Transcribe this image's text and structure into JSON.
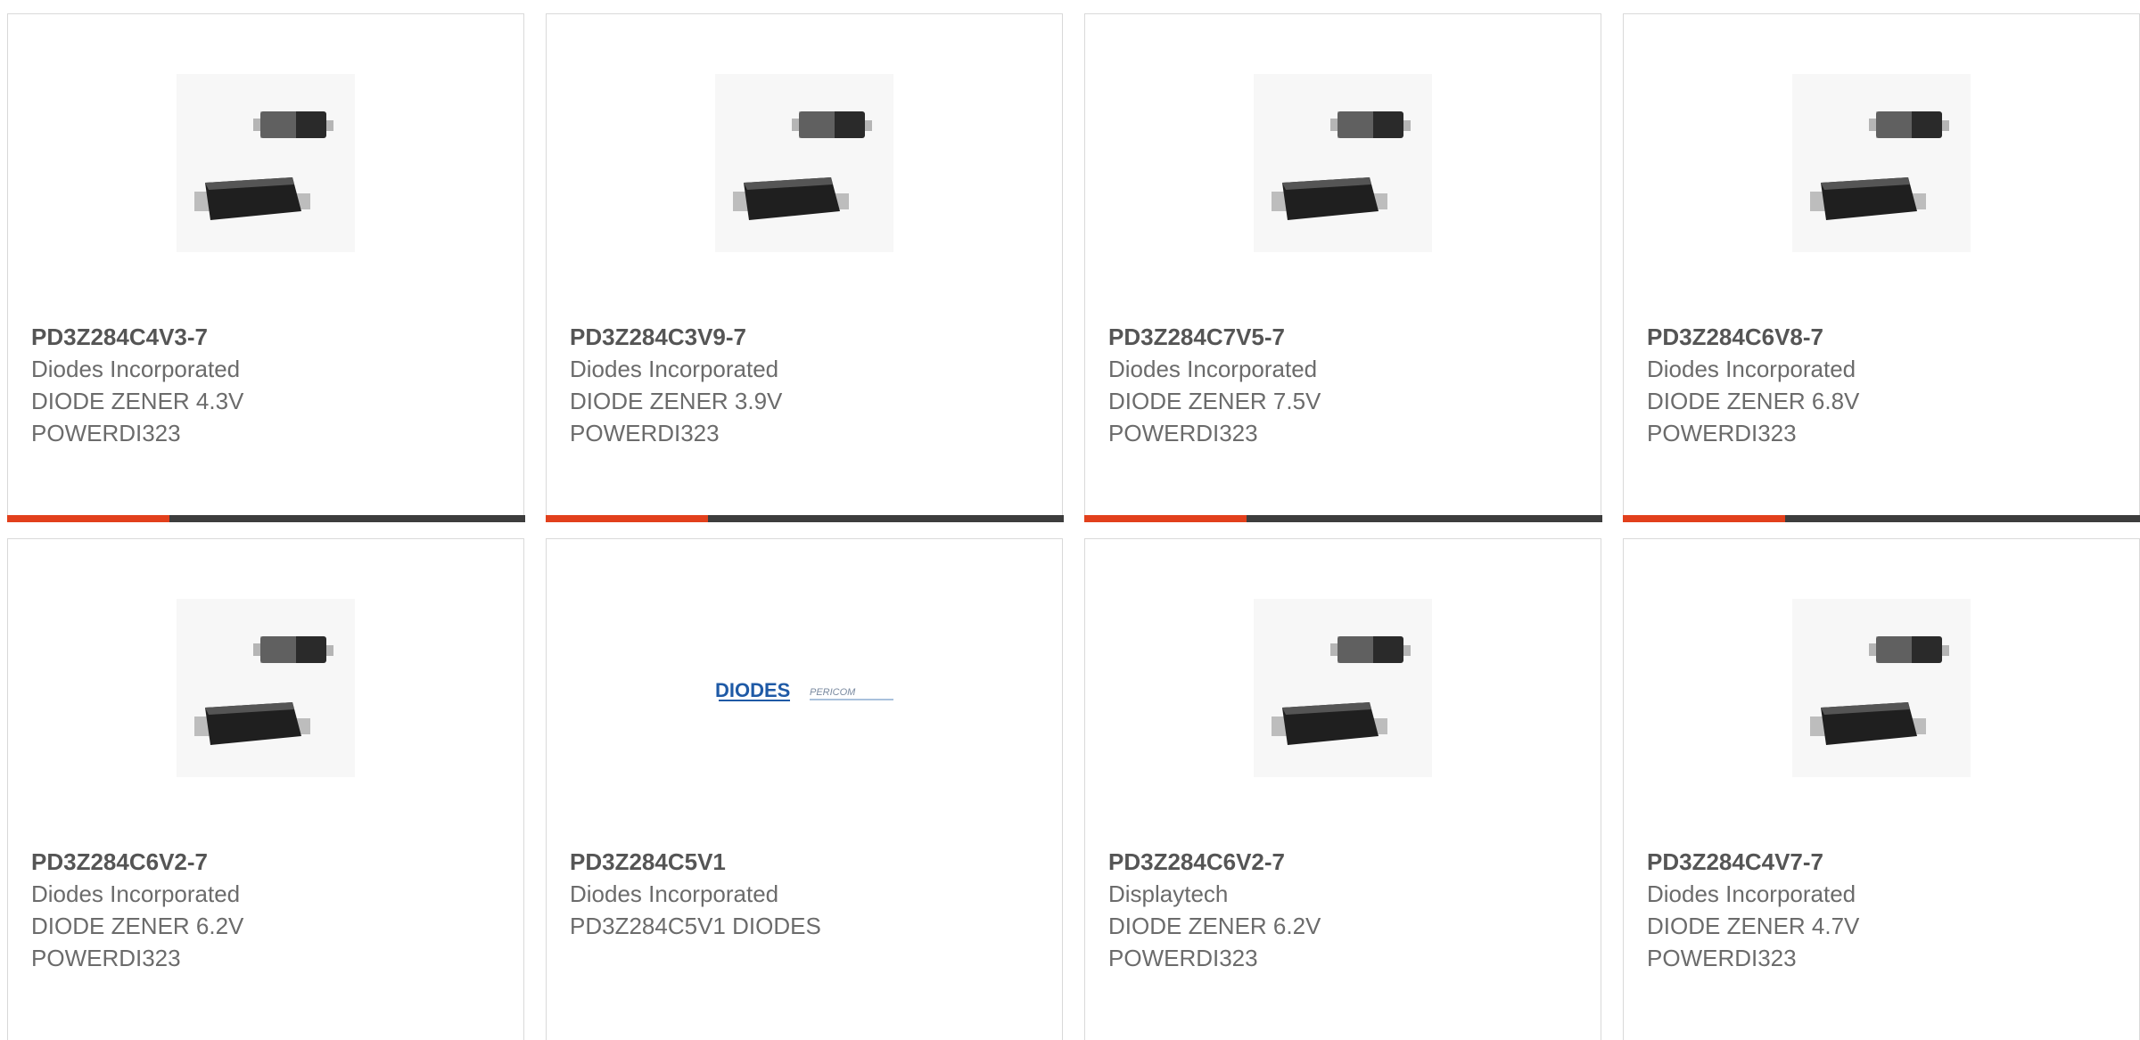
{
  "products": [
    {
      "part_number": "PD3Z284C4V3-7",
      "manufacturer": "Diodes Incorporated",
      "description_line1": "DIODE ZENER 4.3V",
      "description_line2": "POWERDI323",
      "image": "diode-package-image"
    },
    {
      "part_number": "PD3Z284C3V9-7",
      "manufacturer": "Diodes Incorporated",
      "description_line1": "DIODE ZENER 3.9V",
      "description_line2": "POWERDI323",
      "image": "diode-package-image"
    },
    {
      "part_number": "PD3Z284C7V5-7",
      "manufacturer": "Diodes Incorporated",
      "description_line1": "DIODE ZENER 7.5V",
      "description_line2": "POWERDI323",
      "image": "diode-package-image"
    },
    {
      "part_number": "PD3Z284C6V8-7",
      "manufacturer": "Diodes Incorporated",
      "description_line1": "DIODE ZENER 6.8V",
      "description_line2": "POWERDI323",
      "image": "diode-package-image"
    },
    {
      "part_number": "PD3Z284C6V2-7",
      "manufacturer": "Diodes Incorporated",
      "description_line1": "DIODE ZENER 6.2V",
      "description_line2": "POWERDI323",
      "image": "diode-package-image"
    },
    {
      "part_number": "PD3Z284C5V1",
      "manufacturer": "Diodes Incorporated",
      "description_line1": "PD3Z284C5V1 DIODES",
      "description_line2": "",
      "image": "diodes-pericom-logo",
      "logo_text_1": "DIODES",
      "logo_text_2": "PERICOM"
    },
    {
      "part_number": "PD3Z284C6V2-7",
      "manufacturer": "Displaytech",
      "description_line1": "DIODE ZENER 6.2V",
      "description_line2": "POWERDI323",
      "image": "diode-package-image"
    },
    {
      "part_number": "PD3Z284C4V7-7",
      "manufacturer": "Diodes Incorporated",
      "description_line1": "DIODE ZENER 4.7V",
      "description_line2": "POWERDI323",
      "image": "diode-package-image"
    }
  ],
  "colors": {
    "accent": "#e2401c",
    "bar": "#3d3d3d",
    "border": "#d9d9d9",
    "text": "#6b6b6b"
  }
}
